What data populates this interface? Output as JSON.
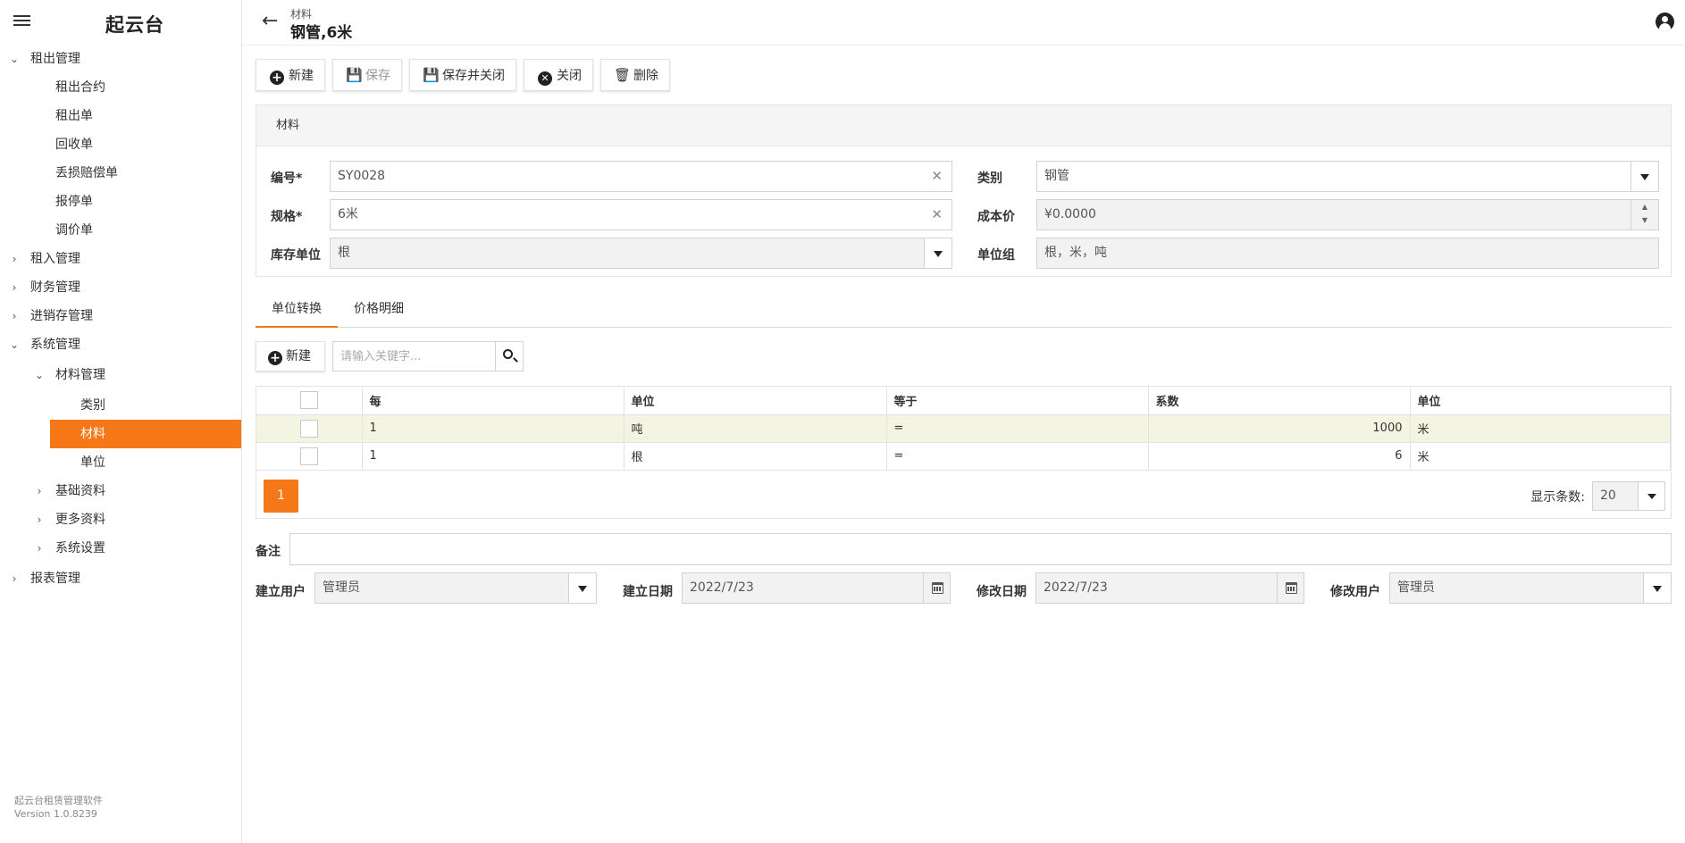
{
  "app": {
    "name": "起云台",
    "footer_line1": "起云台租赁管理软件",
    "footer_line2": "Version 1.0.8239"
  },
  "sidebar": {
    "items": [
      {
        "label": "租出管理",
        "level": 0,
        "expanded": true
      },
      {
        "label": "租出合约",
        "level": 1
      },
      {
        "label": "租出单",
        "level": 1
      },
      {
        "label": "回收单",
        "level": 1
      },
      {
        "label": "丢损赔偿单",
        "level": 1
      },
      {
        "label": "报停单",
        "level": 1
      },
      {
        "label": "调价单",
        "level": 1
      },
      {
        "label": "租入管理",
        "level": 0,
        "expanded": false
      },
      {
        "label": "财务管理",
        "level": 0,
        "expanded": false
      },
      {
        "label": "进销存管理",
        "level": 0,
        "expanded": false
      },
      {
        "label": "系统管理",
        "level": 0,
        "expanded": true
      },
      {
        "label": "材料管理",
        "level": 1,
        "expanded": true
      },
      {
        "label": "类别",
        "level": 2
      },
      {
        "label": "材料",
        "level": 2,
        "active": true
      },
      {
        "label": "单位",
        "level": 2
      },
      {
        "label": "基础资料",
        "level": 1,
        "expanded": false
      },
      {
        "label": "更多资料",
        "level": 1,
        "expanded": false
      },
      {
        "label": "系统设置",
        "level": 1,
        "expanded": false
      },
      {
        "label": "报表管理",
        "level": 0,
        "expanded": false
      }
    ]
  },
  "header": {
    "breadcrumb": "材料",
    "title": "钢管,6米"
  },
  "toolbar": {
    "new_label": "新建",
    "save_label": "保存",
    "save_close_label": "保存并关闭",
    "close_label": "关闭",
    "delete_label": "删除"
  },
  "form": {
    "section_title": "材料",
    "code_label": "编号*",
    "code_value": "SY0028",
    "spec_label": "规格*",
    "spec_value": "6米",
    "stock_unit_label": "库存单位",
    "stock_unit_value": "根",
    "category_label": "类别",
    "category_value": "钢管",
    "cost_label": "成本价",
    "cost_value": "¥0.0000",
    "unit_group_label": "单位组",
    "unit_group_value": "根，米，吨"
  },
  "tabs": [
    {
      "label": "单位转换",
      "active": true
    },
    {
      "label": "价格明细",
      "active": false
    }
  ],
  "subtoolbar": {
    "new_label": "新建",
    "search_placeholder": "请输入关键字..."
  },
  "grid": {
    "columns": [
      "每",
      "单位",
      "等于",
      "系数",
      "单位"
    ],
    "rows": [
      {
        "per": "1",
        "unit": "吨",
        "eq": "=",
        "factor": "1000",
        "unit2": "米",
        "selected": true
      },
      {
        "per": "1",
        "unit": "根",
        "eq": "=",
        "factor": "6",
        "unit2": "米",
        "selected": false
      }
    ],
    "current_page": "1",
    "page_size_label": "显示条数:",
    "page_size": "20"
  },
  "footer_form": {
    "note_label": "备注",
    "note_value": "",
    "created_by_label": "建立用户",
    "created_by": "管理员",
    "created_date_label": "建立日期",
    "created_date": "2022/7/23",
    "modified_date_label": "修改日期",
    "modified_date": "2022/7/23",
    "modified_by_label": "修改用户",
    "modified_by": "管理员"
  },
  "colors": {
    "accent": "#f57717",
    "selected_row": "#f4f4e2"
  }
}
